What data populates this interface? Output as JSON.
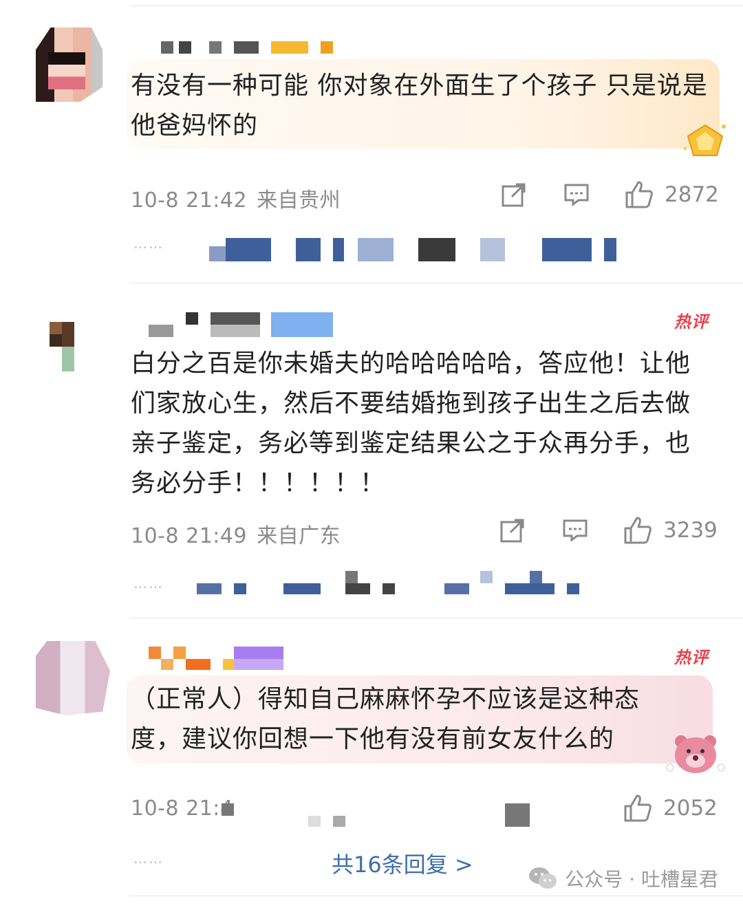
{
  "comments": [
    {
      "text": "有没有一种可能 你对象在外面生了个孩子 只是说是他爸妈怀的",
      "time": "10-8 21:42",
      "region": "来自贵州",
      "likes": "2872",
      "hot": "",
      "footer": "",
      "sticker": "crown-badge-icon"
    },
    {
      "text": "白分之百是你未婚夫的哈哈哈哈哈，答应他！让他们家放心生，然后不要结婚拖到孩子出生之后去做亲子鉴定，务必等到鉴定结果公之于众再分手，也务必分手！！！！！！",
      "time": "10-8 21:49",
      "region": "来自广东",
      "likes": "3239",
      "hot": "热评",
      "footer": ""
    },
    {
      "text": "（正常人）得知自己麻麻怀孕不应该是这种态度，建议你回想一下他有没有前女友什么的",
      "time": "10-8 21:4",
      "region": "",
      "likes": "2052",
      "hot": "热评",
      "footer": "共16条回复 >",
      "sticker": "lotso-bear-icon"
    }
  ],
  "dots": "……",
  "watermark": {
    "text": "公众号 · 吐槽星君",
    "icon": "wechat-icon"
  },
  "colors": {
    "text": "#222222",
    "meta": "#8a8a8a",
    "hot": "#e8424f",
    "link": "#3f6fa8"
  }
}
